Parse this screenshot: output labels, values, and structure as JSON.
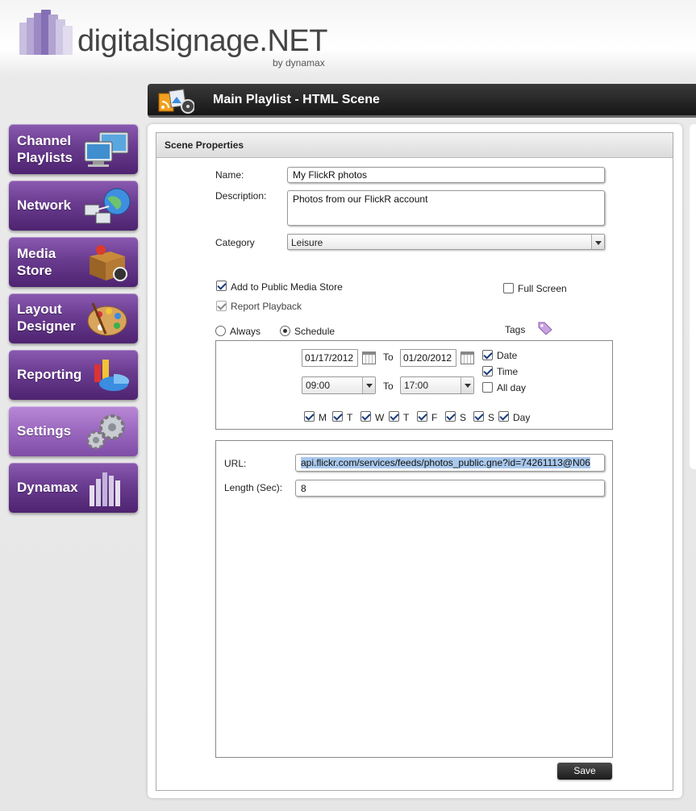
{
  "brand": {
    "logo_text": "digitalsignage.NET",
    "logo_sub": "by dynamax"
  },
  "sidebar": {
    "items": [
      {
        "label_line1": "Channel",
        "label_line2": "Playlists",
        "icon": "monitors-icon"
      },
      {
        "label_line1": "Network",
        "label_line2": "",
        "icon": "network-globe-icon"
      },
      {
        "label_line1": "Media",
        "label_line2": "Store",
        "icon": "media-box-icon"
      },
      {
        "label_line1": "Layout",
        "label_line2": "Designer",
        "icon": "palette-icon"
      },
      {
        "label_line1": "Reporting",
        "label_line2": "",
        "icon": "chart-icon"
      },
      {
        "label_line1": "Settings",
        "label_line2": "",
        "icon": "gears-icon",
        "active": true
      },
      {
        "label_line1": "Dynamax",
        "label_line2": "",
        "icon": "dynamax-logo-icon"
      }
    ]
  },
  "title_bar": {
    "title": "Main Playlist - HTML Scene"
  },
  "scene": {
    "header": "Scene Properties",
    "name_label": "Name:",
    "name_value": "My FlickR photos",
    "description_label": "Description:",
    "description_value": "Photos from our FlickR account",
    "category_label": "Category",
    "category_value": "Leisure",
    "public_store_label": "Add to Public Media Store",
    "report_playback_label": "Report Playback",
    "full_screen_label": "Full Screen",
    "always_label": "Always",
    "schedule_label": "Schedule",
    "tags_label": "Tags"
  },
  "schedule": {
    "date_from": "01/17/2012",
    "to_label": "To",
    "date_to": "01/20/2012",
    "time_from": "09:00",
    "time_to": "17:00",
    "date_label": "Date",
    "time_label": "Time",
    "allday_label": "All day",
    "days": [
      "M",
      "T",
      "W",
      "T",
      "F",
      "S",
      "S",
      "Day"
    ]
  },
  "html_scene": {
    "url_label": "URL:",
    "url_value": "api.flickr.com/services/feeds/photos_public.gne?id=74261113@N06",
    "length_label": "Length (Sec):",
    "length_value": "8"
  },
  "actions": {
    "save_label": "Save"
  },
  "colors": {
    "nav_purple": "#6a3c90",
    "nav_active": "#9a68bf",
    "title_bar": "#1c1c1c"
  }
}
